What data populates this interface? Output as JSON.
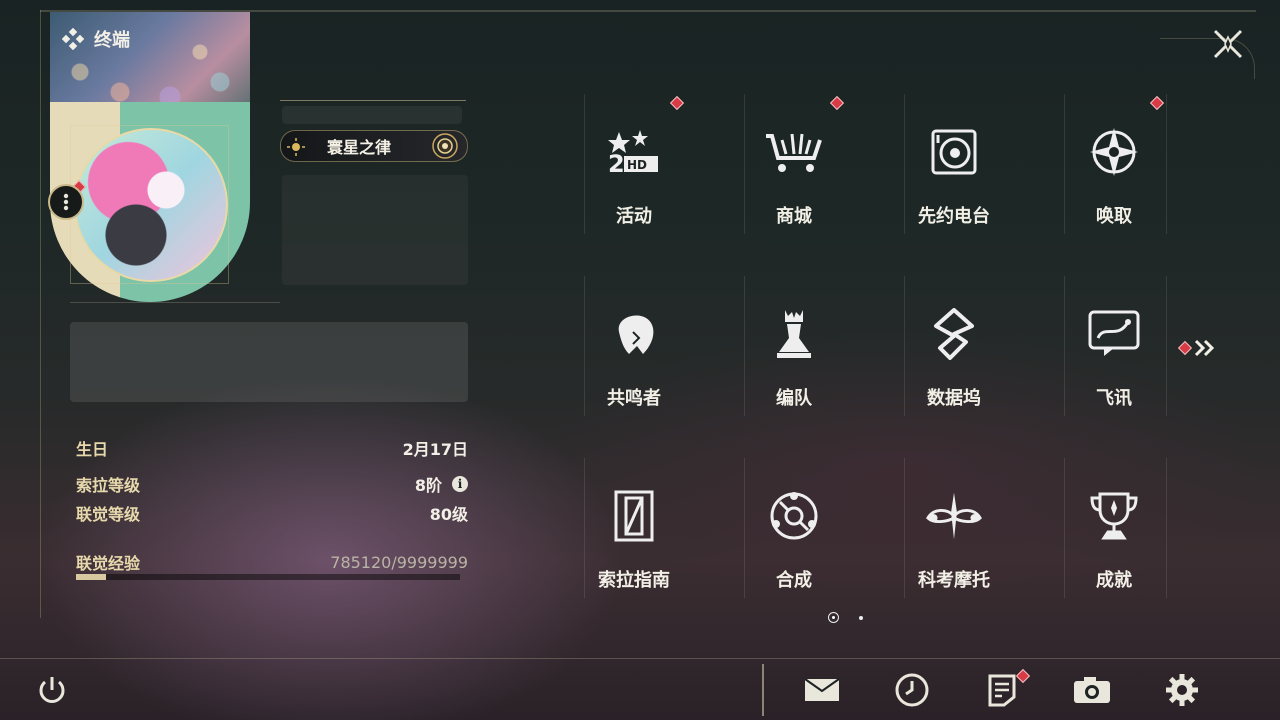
{
  "header": {
    "title": "终端"
  },
  "profile": {
    "title_badge": "寰星之律",
    "birthday_label": "生日",
    "birthday_value": "2月17日",
    "sola_level_label": "索拉等级",
    "sola_level_value": "8阶",
    "union_level_label": "联觉等级",
    "union_level_value": "80级",
    "union_exp_label": "联觉经验",
    "union_exp_value": "785120/9999999",
    "union_exp_progress": 0.0785
  },
  "menu": {
    "items": [
      {
        "label": "活动",
        "icon": "event-icon",
        "badge": true
      },
      {
        "label": "商城",
        "icon": "shop-cart-icon",
        "badge": true
      },
      {
        "label": "先约电台",
        "icon": "radio-icon",
        "badge": false
      },
      {
        "label": "唤取",
        "icon": "convene-compass-icon",
        "badge": true
      },
      {
        "label": "共鸣者",
        "icon": "resonator-icon",
        "badge": false
      },
      {
        "label": "编队",
        "icon": "team-chess-icon",
        "badge": false
      },
      {
        "label": "数据坞",
        "icon": "data-bank-icon",
        "badge": false
      },
      {
        "label": "飞讯",
        "icon": "message-icon",
        "badge": false
      },
      {
        "label": "索拉指南",
        "icon": "guide-icon",
        "badge": false
      },
      {
        "label": "合成",
        "icon": "synthesis-icon",
        "badge": false
      },
      {
        "label": "科考摩托",
        "icon": "motorcycle-icon",
        "badge": false
      },
      {
        "label": "成就",
        "icon": "trophy-icon",
        "badge": false
      }
    ]
  },
  "pagination": {
    "current": 1,
    "total": 2
  },
  "bottom_bar": {
    "icons": [
      "power-icon",
      "mail-icon",
      "clock-icon",
      "notes-icon",
      "camera-icon",
      "settings-icon"
    ]
  },
  "colors": {
    "accent": "#d8c9a0",
    "badge": "#d63b46",
    "text": "#f2efe6"
  }
}
